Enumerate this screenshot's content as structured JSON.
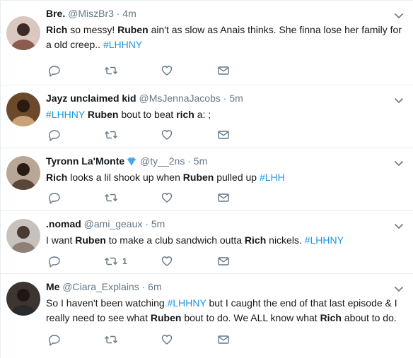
{
  "tweets": [
    {
      "name": "Bre.",
      "handle": "@MiszBr3",
      "time": "4m",
      "segments": [
        {
          "t": "Rich",
          "s": "b"
        },
        {
          "t": " so messy! ",
          "s": ""
        },
        {
          "t": "Ruben",
          "s": "b"
        },
        {
          "t": " ain't as slow as Anais thinks. She finna lose her family for a old creep.. ",
          "s": ""
        },
        {
          "t": "#LHHNY",
          "s": "tag"
        }
      ],
      "retweet_count": "",
      "avatar": {
        "bg": "#d9c7c0",
        "fg": "#3b2a28",
        "shirt": "#8a5b4e"
      }
    },
    {
      "name": "Jayz unclaimed kid",
      "handle": "@MsJennaJacobs",
      "time": "5m",
      "segments": [
        {
          "t": "#LHHNY",
          "s": "tag"
        },
        {
          "t": " ",
          "s": ""
        },
        {
          "t": "Ruben",
          "s": "b"
        },
        {
          "t": " bout to beat ",
          "s": ""
        },
        {
          "t": "rich",
          "s": "b"
        },
        {
          "t": " a: ;",
          "s": ""
        }
      ],
      "retweet_count": "",
      "avatar": {
        "bg": "#6b4a2b",
        "fg": "#2a1a10",
        "shirt": "#c9a27a"
      }
    },
    {
      "name": "Tyronn La'Monte",
      "handle": "@ty__2ns",
      "time": "5m",
      "verified_emoji": "gem-icon",
      "segments": [
        {
          "t": "Rich",
          "s": "b"
        },
        {
          "t": " looks a lil shook up when ",
          "s": ""
        },
        {
          "t": "Ruben",
          "s": "b"
        },
        {
          "t": " pulled up ",
          "s": ""
        },
        {
          "t": "#LHH",
          "s": "tag"
        }
      ],
      "retweet_count": "",
      "avatar": {
        "bg": "#b8a796",
        "fg": "#2a1c14",
        "shirt": "#5a4638"
      }
    },
    {
      "name": ".nomad",
      "handle": "@ami_geaux",
      "time": "5m",
      "segments": [
        {
          "t": "I want ",
          "s": ""
        },
        {
          "t": "Ruben",
          "s": "b"
        },
        {
          "t": " to make a club sandwich outta ",
          "s": ""
        },
        {
          "t": "Rich",
          "s": "b"
        },
        {
          "t": " nickels. ",
          "s": ""
        },
        {
          "t": "#LHHNY",
          "s": "tag"
        }
      ],
      "retweet_count": "1",
      "avatar": {
        "bg": "#c7c2bd",
        "fg": "#4a3a33",
        "shirt": "#8f7f76"
      }
    },
    {
      "name": "Me",
      "handle": "@Ciara_Explains",
      "time": "6m",
      "segments": [
        {
          "t": "So I haven't been watching ",
          "s": ""
        },
        {
          "t": "#LHHNY",
          "s": "tag"
        },
        {
          "t": " but I caught the end of that last episode & I really need to see what ",
          "s": ""
        },
        {
          "t": "Ruben",
          "s": "b"
        },
        {
          "t": " bout to do. We ALL know what ",
          "s": ""
        },
        {
          "t": "Rich",
          "s": "b"
        },
        {
          "t": " about to do.",
          "s": ""
        }
      ],
      "retweet_count": "",
      "avatar": {
        "bg": "#3d3530",
        "fg": "#1e1814",
        "shirt": "#2b2a2a"
      }
    }
  ],
  "icons": {
    "reply": "reply-icon",
    "retweet": "retweet-icon",
    "like": "heart-icon",
    "message": "envelope-icon",
    "menu": "chevron-down-icon"
  },
  "colors": {
    "text": "#14171a",
    "muted": "#657786",
    "hashtag": "#1b95e0",
    "icon": "#657786",
    "divider": "#e6ecf0"
  }
}
